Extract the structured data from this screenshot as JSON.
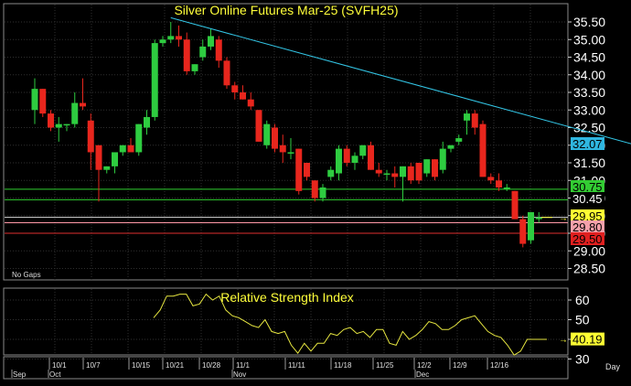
{
  "window": {
    "title": "Silver Online Futures Mar-25 (SVFH25)",
    "gaps_label": "No Gaps",
    "indicator_title": "Relative Strength Index",
    "period_label": "Day"
  },
  "colors": {
    "background": "#000000",
    "border": "#8a8a8a",
    "grid": "#2f2f2f",
    "up_candle": "#2ecc40",
    "down_candle": "#e8261d",
    "title_text": "#ffff3a",
    "trendline": "#33c6e6",
    "rsi_line": "#e6e640",
    "support_line": "#30d030",
    "resistance_line": "#e03030",
    "pink_line": "#ff9aa8"
  },
  "price_axis": {
    "ticks": [
      "35.50",
      "35.00",
      "34.50",
      "34.00",
      "33.50",
      "33.00",
      "32.50",
      "32.00",
      "31.50",
      "31.00",
      "30.50",
      "30.00",
      "29.50",
      "29.00",
      "28.50"
    ]
  },
  "rsi_axis": {
    "ticks": [
      "60",
      "50",
      "40",
      "30"
    ]
  },
  "price_labels": [
    {
      "text": "32.07",
      "bg": "#2fb6e0",
      "fg": "#000000"
    },
    {
      "text": "30.75",
      "bg": "#33cc33",
      "fg": "#000000"
    },
    {
      "text": "30.45",
      "bg": "#000000",
      "fg": "#ffffff"
    },
    {
      "text": "29.95",
      "bg": "#ffff33",
      "fg": "#000000"
    },
    {
      "text": "29.80",
      "bg": "#f4a0aa",
      "fg": "#000000"
    },
    {
      "text": "29.50",
      "bg": "#e02020",
      "fg": "#000000"
    }
  ],
  "rsi_label": {
    "text": "40.19",
    "bg": "#ffff33",
    "fg": "#000000"
  },
  "date_axis": {
    "day_labels": [
      "10/1",
      "10/7",
      "10/15",
      "10/21",
      "10/28",
      "11/1",
      "11/11",
      "11/18",
      "11/25",
      "12/2",
      "12/9",
      "12/16"
    ],
    "month_labels": [
      "Sep",
      "Oct",
      "Nov",
      "Dec"
    ]
  },
  "chart_data": {
    "type": "candlestick",
    "title": "Silver Online Futures Mar-25 (SVFH25)",
    "ylim": [
      28.2,
      35.8
    ],
    "candles": [
      {
        "o": 33.0,
        "h": 33.9,
        "l": 32.6,
        "c": 33.6
      },
      {
        "o": 33.6,
        "h": 33.6,
        "l": 32.8,
        "c": 32.9
      },
      {
        "o": 32.9,
        "h": 33.0,
        "l": 32.4,
        "c": 32.5
      },
      {
        "o": 32.5,
        "h": 32.8,
        "l": 32.1,
        "c": 32.6
      },
      {
        "o": 32.6,
        "h": 32.6,
        "l": 32.4,
        "c": 32.6
      },
      {
        "o": 32.6,
        "h": 33.5,
        "l": 32.5,
        "c": 33.2
      },
      {
        "o": 33.2,
        "h": 33.9,
        "l": 33.0,
        "c": 33.1
      },
      {
        "o": 32.7,
        "h": 32.9,
        "l": 31.3,
        "c": 31.8
      },
      {
        "o": 32.0,
        "h": 32.0,
        "l": 30.4,
        "c": 31.3
      },
      {
        "o": 31.3,
        "h": 31.4,
        "l": 31.2,
        "c": 31.4
      },
      {
        "o": 31.4,
        "h": 31.8,
        "l": 31.2,
        "c": 31.8
      },
      {
        "o": 31.8,
        "h": 32.0,
        "l": 31.7,
        "c": 32.0
      },
      {
        "o": 32.0,
        "h": 32.2,
        "l": 31.9,
        "c": 31.8
      },
      {
        "o": 31.8,
        "h": 32.6,
        "l": 31.7,
        "c": 32.6
      },
      {
        "o": 32.5,
        "h": 33.0,
        "l": 32.3,
        "c": 32.8
      },
      {
        "o": 32.8,
        "h": 35.0,
        "l": 32.7,
        "c": 34.9
      },
      {
        "o": 34.9,
        "h": 35.1,
        "l": 34.8,
        "c": 35.0
      },
      {
        "o": 35.0,
        "h": 35.5,
        "l": 34.9,
        "c": 35.1
      },
      {
        "o": 35.1,
        "h": 35.4,
        "l": 34.8,
        "c": 35.0
      },
      {
        "o": 35.0,
        "h": 35.2,
        "l": 34.0,
        "c": 34.1
      },
      {
        "o": 34.1,
        "h": 34.3,
        "l": 34.0,
        "c": 34.3
      },
      {
        "o": 34.5,
        "h": 35.0,
        "l": 34.4,
        "c": 34.8
      },
      {
        "o": 34.8,
        "h": 35.3,
        "l": 34.7,
        "c": 35.1
      },
      {
        "o": 35.0,
        "h": 35.1,
        "l": 34.2,
        "c": 34.4
      },
      {
        "o": 34.4,
        "h": 34.5,
        "l": 33.6,
        "c": 33.7
      },
      {
        "o": 33.7,
        "h": 33.8,
        "l": 33.3,
        "c": 33.5
      },
      {
        "o": 33.5,
        "h": 33.7,
        "l": 33.3,
        "c": 33.3
      },
      {
        "o": 33.3,
        "h": 33.5,
        "l": 33.0,
        "c": 33.1
      },
      {
        "o": 33.0,
        "h": 33.0,
        "l": 32.1,
        "c": 32.1
      },
      {
        "o": 32.0,
        "h": 32.7,
        "l": 31.9,
        "c": 32.6
      },
      {
        "o": 32.5,
        "h": 32.6,
        "l": 31.8,
        "c": 31.9
      },
      {
        "o": 32.0,
        "h": 32.3,
        "l": 31.5,
        "c": 31.8
      },
      {
        "o": 31.8,
        "h": 32.2,
        "l": 31.6,
        "c": 31.8
      },
      {
        "o": 31.9,
        "h": 31.9,
        "l": 30.6,
        "c": 30.7
      },
      {
        "o": 31.5,
        "h": 31.5,
        "l": 31.0,
        "c": 31.1
      },
      {
        "o": 31.0,
        "h": 31.0,
        "l": 30.4,
        "c": 30.5
      },
      {
        "o": 30.5,
        "h": 30.9,
        "l": 30.4,
        "c": 30.8
      },
      {
        "o": 31.1,
        "h": 31.4,
        "l": 31.0,
        "c": 31.3
      },
      {
        "o": 31.2,
        "h": 32.0,
        "l": 31.0,
        "c": 31.9
      },
      {
        "o": 31.9,
        "h": 32.0,
        "l": 31.4,
        "c": 31.5
      },
      {
        "o": 31.5,
        "h": 31.8,
        "l": 31.3,
        "c": 31.7
      },
      {
        "o": 31.7,
        "h": 32.0,
        "l": 31.6,
        "c": 32.0
      },
      {
        "o": 32.0,
        "h": 32.1,
        "l": 31.3,
        "c": 31.3
      },
      {
        "o": 31.3,
        "h": 31.5,
        "l": 31.1,
        "c": 31.2
      },
      {
        "o": 31.2,
        "h": 31.3,
        "l": 31.0,
        "c": 31.2
      },
      {
        "o": 31.2,
        "h": 31.4,
        "l": 30.8,
        "c": 31.1
      },
      {
        "o": 31.1,
        "h": 31.4,
        "l": 30.4,
        "c": 31.4
      },
      {
        "o": 31.4,
        "h": 31.5,
        "l": 30.9,
        "c": 31.0
      },
      {
        "o": 31.5,
        "h": 31.5,
        "l": 30.9,
        "c": 31.0
      },
      {
        "o": 31.2,
        "h": 31.6,
        "l": 31.1,
        "c": 31.6
      },
      {
        "o": 31.6,
        "h": 31.6,
        "l": 31.0,
        "c": 31.1
      },
      {
        "o": 31.3,
        "h": 32.1,
        "l": 31.2,
        "c": 31.9
      },
      {
        "o": 31.9,
        "h": 32.0,
        "l": 31.8,
        "c": 32.0
      },
      {
        "o": 32.1,
        "h": 32.3,
        "l": 32.0,
        "c": 32.2
      },
      {
        "o": 32.7,
        "h": 33.0,
        "l": 32.3,
        "c": 32.9
      },
      {
        "o": 32.9,
        "h": 33.0,
        "l": 32.3,
        "c": 32.5
      },
      {
        "o": 32.6,
        "h": 32.7,
        "l": 31.1,
        "c": 31.1
      },
      {
        "o": 31.1,
        "h": 31.2,
        "l": 30.9,
        "c": 31.0
      },
      {
        "o": 31.0,
        "h": 31.2,
        "l": 30.7,
        "c": 30.8
      },
      {
        "o": 30.8,
        "h": 30.9,
        "l": 30.7,
        "c": 30.8
      },
      {
        "o": 30.7,
        "h": 30.7,
        "l": 29.9,
        "c": 29.9
      },
      {
        "o": 29.9,
        "h": 30.0,
        "l": 29.1,
        "c": 29.2
      },
      {
        "o": 29.3,
        "h": 30.1,
        "l": 29.2,
        "c": 30.1
      },
      {
        "o": 29.9,
        "h": 30.1,
        "l": 29.8,
        "c": 29.95
      }
    ],
    "trendline": {
      "from_index": 17,
      "from_price": 35.62,
      "to_index": 76,
      "to_price": 31.95
    },
    "horizontal_lines": [
      {
        "price": 30.75,
        "color": "green"
      },
      {
        "price": 30.45,
        "color": "green"
      },
      {
        "price": 29.95,
        "color": "yellow"
      },
      {
        "price": 29.8,
        "color": "pink"
      },
      {
        "price": 29.5,
        "color": "red"
      }
    ],
    "rsi": {
      "ylim": [
        25,
        65
      ],
      "values": [
        51,
        55,
        62,
        62,
        63,
        63,
        57,
        58,
        63,
        60,
        62,
        55,
        52,
        51,
        49,
        47,
        46,
        50,
        44,
        43,
        44,
        37,
        33,
        38,
        34,
        38,
        38,
        43,
        42,
        45,
        46,
        43,
        44,
        41,
        45,
        45,
        38,
        37,
        44,
        40,
        42,
        45,
        49,
        48,
        45,
        45,
        47,
        50,
        51,
        52,
        48,
        44,
        42,
        41,
        37,
        32,
        34,
        40,
        40,
        40,
        40
      ]
    }
  }
}
